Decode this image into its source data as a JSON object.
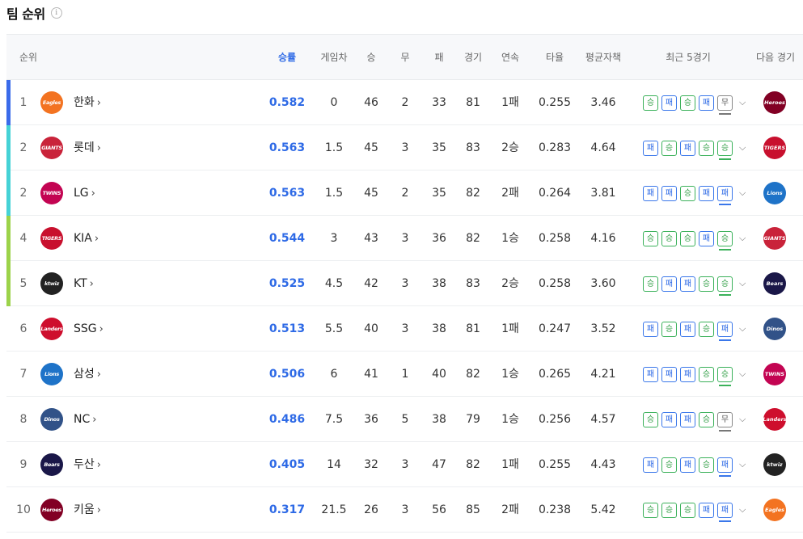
{
  "header": {
    "title": "팀 순위",
    "info_icon": "info-icon"
  },
  "columns": {
    "rank": "순위",
    "win_pct": "승률",
    "games_behind": "게임차",
    "wins": "승",
    "draws": "무",
    "losses": "패",
    "games": "경기",
    "streak": "연속",
    "avg": "타율",
    "era": "평균자책",
    "recent5": "최근 5경기",
    "next": "다음 경기"
  },
  "colors": {
    "accent": "#2e6ae6",
    "win": "#3bb15a",
    "loss": "#3a77ea",
    "draw": "#777777",
    "bar_first": "#3a6bea",
    "bar_cyan": "#45d2d6",
    "bar_green": "#9cd34a"
  },
  "team_logos": {
    "한화": {
      "color": "#f37321",
      "mark": "Eagles"
    },
    "롯데": {
      "color": "#c9233a",
      "mark": "GIANTS"
    },
    "LG": {
      "color": "#c30452",
      "mark": "TWINS"
    },
    "KIA": {
      "color": "#c8102e",
      "mark": "TIGERS"
    },
    "KT": {
      "color": "#222222",
      "mark": "ktwiz"
    },
    "SSG": {
      "color": "#ce0e2d",
      "mark": "Landers"
    },
    "삼성": {
      "color": "#1e73c8",
      "mark": "Lions"
    },
    "NC": {
      "color": "#315288",
      "mark": "Dinos"
    },
    "두산": {
      "color": "#1a1748",
      "mark": "Bears"
    },
    "키움": {
      "color": "#820024",
      "mark": "Heroes"
    }
  },
  "rows": [
    {
      "rank": "1",
      "team": "한화",
      "win_pct": "0.582",
      "gb": "0",
      "w": "46",
      "d": "2",
      "l": "33",
      "g": "81",
      "streak": "1패",
      "avg": "0.255",
      "era": "3.46",
      "bar": "bar_first",
      "recent": [
        "승",
        "패",
        "승",
        "패",
        "무"
      ],
      "next": "키움"
    },
    {
      "rank": "2",
      "team": "롯데",
      "win_pct": "0.563",
      "gb": "1.5",
      "w": "45",
      "d": "3",
      "l": "35",
      "g": "83",
      "streak": "2승",
      "avg": "0.283",
      "era": "4.64",
      "bar": "bar_cyan",
      "recent": [
        "패",
        "승",
        "패",
        "승",
        "승"
      ],
      "next": "KIA"
    },
    {
      "rank": "2",
      "team": "LG",
      "win_pct": "0.563",
      "gb": "1.5",
      "w": "45",
      "d": "2",
      "l": "35",
      "g": "82",
      "streak": "2패",
      "avg": "0.264",
      "era": "3.81",
      "bar": "bar_cyan",
      "recent": [
        "패",
        "패",
        "승",
        "패",
        "패"
      ],
      "next": "삼성"
    },
    {
      "rank": "4",
      "team": "KIA",
      "win_pct": "0.544",
      "gb": "3",
      "w": "43",
      "d": "3",
      "l": "36",
      "g": "82",
      "streak": "1승",
      "avg": "0.258",
      "era": "4.16",
      "bar": "bar_green",
      "recent": [
        "승",
        "승",
        "승",
        "패",
        "승"
      ],
      "next": "롯데"
    },
    {
      "rank": "5",
      "team": "KT",
      "win_pct": "0.525",
      "gb": "4.5",
      "w": "42",
      "d": "3",
      "l": "38",
      "g": "83",
      "streak": "2승",
      "avg": "0.258",
      "era": "3.60",
      "bar": "bar_green",
      "recent": [
        "승",
        "패",
        "패",
        "승",
        "승"
      ],
      "next": "두산"
    },
    {
      "rank": "6",
      "team": "SSG",
      "win_pct": "0.513",
      "gb": "5.5",
      "w": "40",
      "d": "3",
      "l": "38",
      "g": "81",
      "streak": "1패",
      "avg": "0.247",
      "era": "3.52",
      "bar": "",
      "recent": [
        "패",
        "승",
        "패",
        "승",
        "패"
      ],
      "next": "NC"
    },
    {
      "rank": "7",
      "team": "삼성",
      "win_pct": "0.506",
      "gb": "6",
      "w": "41",
      "d": "1",
      "l": "40",
      "g": "82",
      "streak": "1승",
      "avg": "0.265",
      "era": "4.21",
      "bar": "",
      "recent": [
        "패",
        "패",
        "패",
        "승",
        "승"
      ],
      "next": "LG"
    },
    {
      "rank": "8",
      "team": "NC",
      "win_pct": "0.486",
      "gb": "7.5",
      "w": "36",
      "d": "5",
      "l": "38",
      "g": "79",
      "streak": "1승",
      "avg": "0.256",
      "era": "4.57",
      "bar": "",
      "recent": [
        "승",
        "패",
        "패",
        "승",
        "무"
      ],
      "next": "SSG"
    },
    {
      "rank": "9",
      "team": "두산",
      "win_pct": "0.405",
      "gb": "14",
      "w": "32",
      "d": "3",
      "l": "47",
      "g": "82",
      "streak": "1패",
      "avg": "0.255",
      "era": "4.43",
      "bar": "",
      "recent": [
        "패",
        "승",
        "패",
        "승",
        "패"
      ],
      "next": "KT"
    },
    {
      "rank": "10",
      "team": "키움",
      "win_pct": "0.317",
      "gb": "21.5",
      "w": "26",
      "d": "3",
      "l": "56",
      "g": "85",
      "streak": "2패",
      "avg": "0.238",
      "era": "5.42",
      "bar": "",
      "recent": [
        "승",
        "승",
        "승",
        "패",
        "패"
      ],
      "next": "한화"
    }
  ]
}
